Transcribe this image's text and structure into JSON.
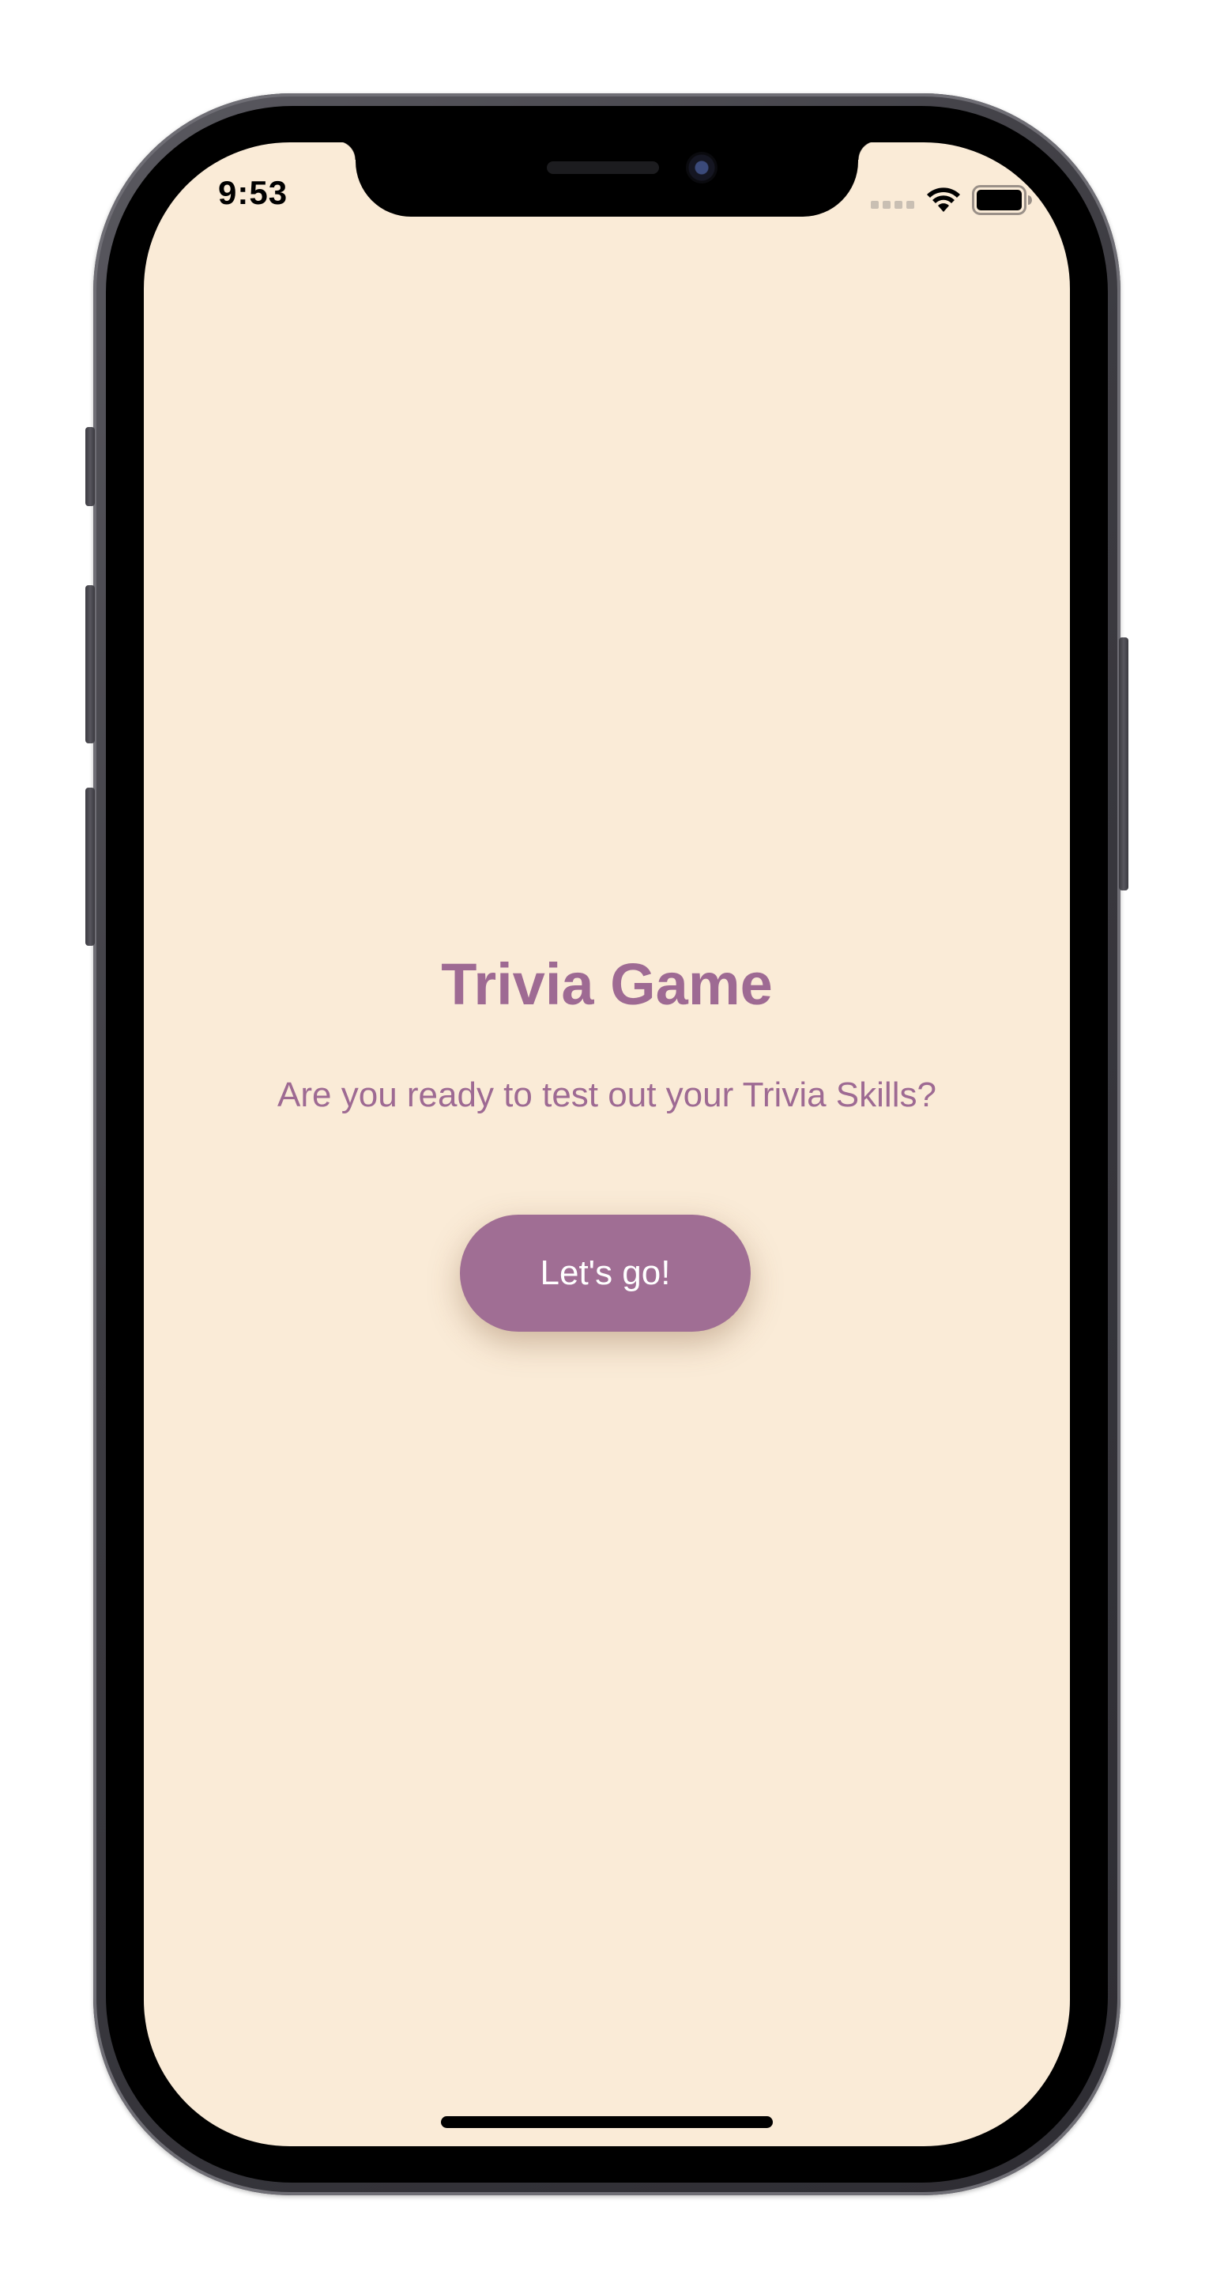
{
  "status_bar": {
    "time": "9:53",
    "signal_icon": "cellular-signal-icon",
    "wifi_icon": "wifi-icon",
    "battery_icon": "battery-icon"
  },
  "main": {
    "title": "Trivia Game",
    "subtitle": "Are you ready to test out your Trivia Skills?",
    "start_button_label": "Let's go!"
  },
  "colors": {
    "background": "#faebd7",
    "accent": "#9e6a93",
    "button_text": "#ffffff"
  }
}
